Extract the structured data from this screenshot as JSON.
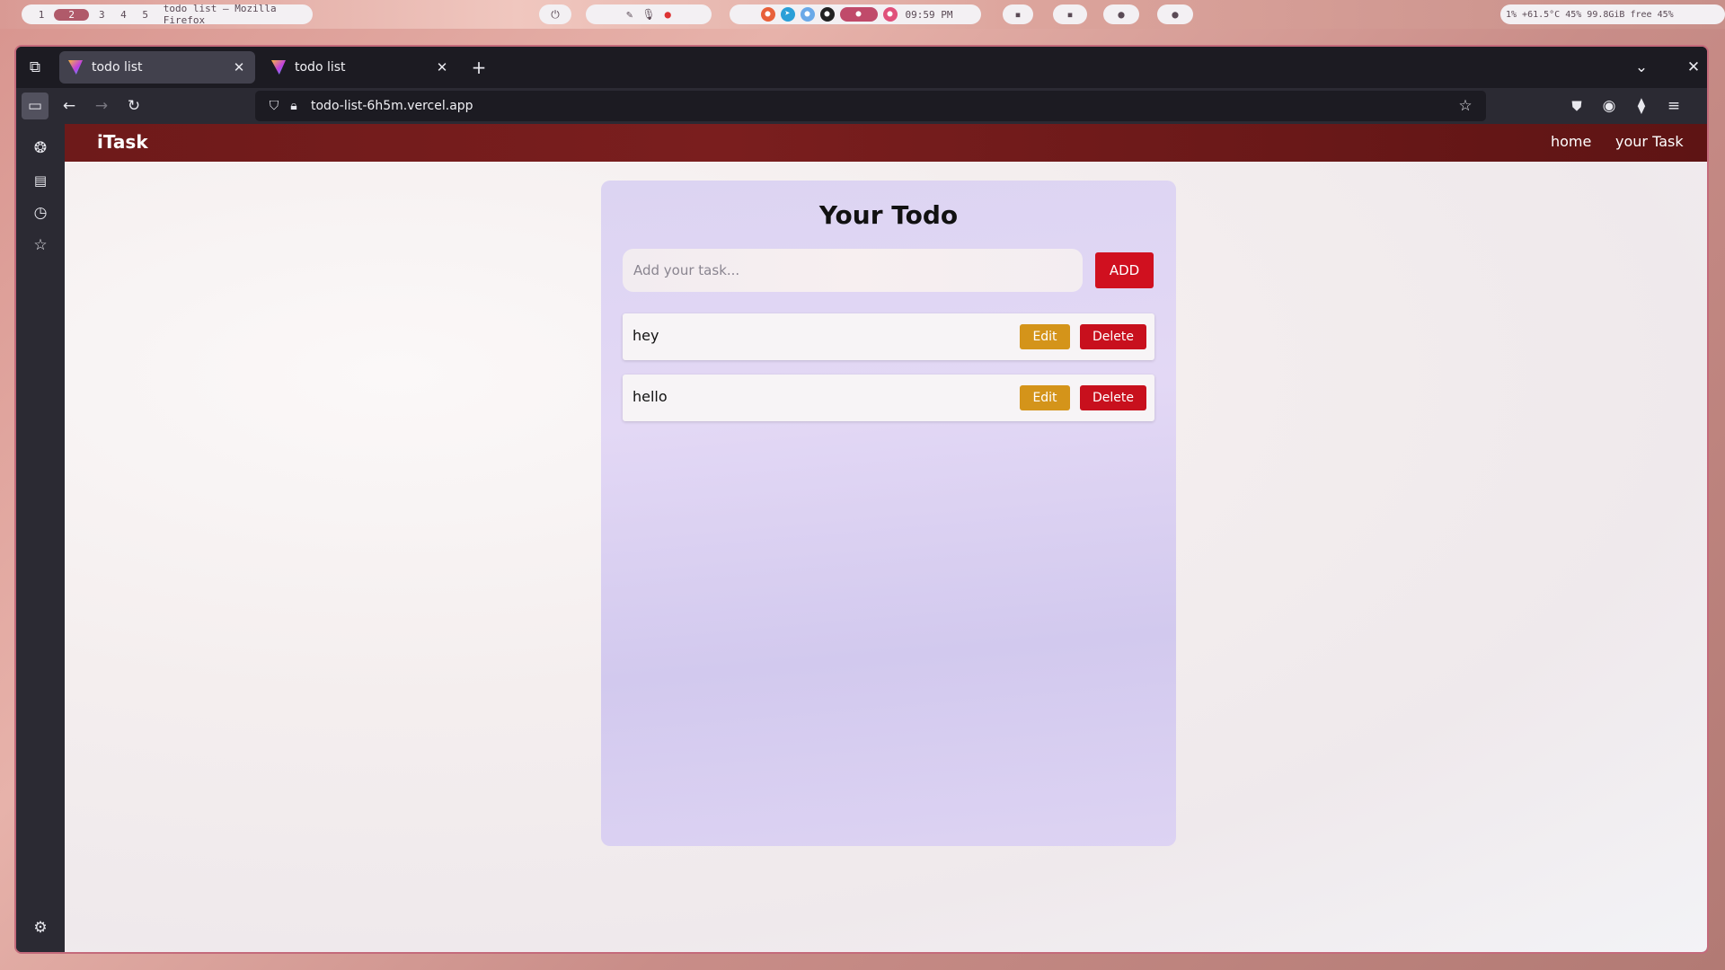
{
  "desktop": {
    "workspaces": [
      "1",
      "2",
      "3",
      "4",
      "5"
    ],
    "active_workspace": "2",
    "window_title": "todo list — Mozilla Firefox",
    "clock": "09:59 PM",
    "system_status": "1%  +61.5°C  45%  99.8GiB free  45%"
  },
  "browser": {
    "tabs": [
      {
        "title": "todo list",
        "active": true
      },
      {
        "title": "todo list",
        "active": false
      }
    ],
    "url": "todo-list-6h5m.vercel.app"
  },
  "site": {
    "brand": "iTask",
    "nav": {
      "home": "home",
      "your_task": "your Task"
    }
  },
  "todo": {
    "title": "Your Todo",
    "input_placeholder": "Add your task...",
    "add_label": "ADD",
    "items": [
      {
        "text": "hey",
        "edit_label": "Edit",
        "delete_label": "Delete"
      },
      {
        "text": "hello",
        "edit_label": "Edit",
        "delete_label": "Delete"
      }
    ]
  },
  "colors": {
    "navbar": "#7a1e1e",
    "add_button": "#d0101f",
    "edit_button": "#d4941a",
    "delete_button": "#c8101d",
    "card": "#dcd4f2"
  }
}
